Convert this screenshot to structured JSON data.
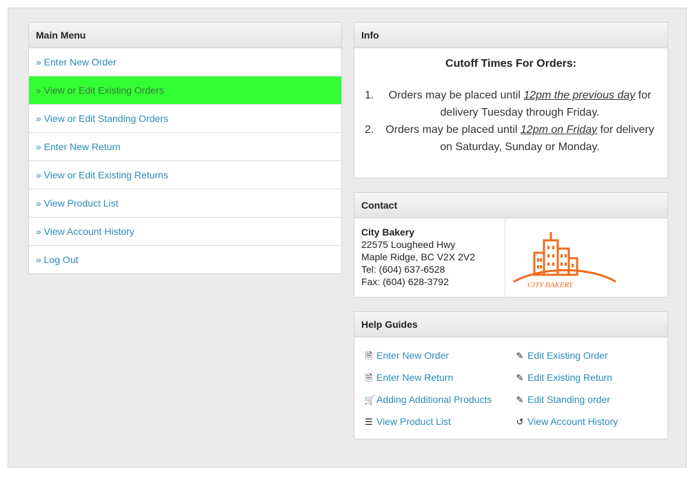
{
  "menu": {
    "title": "Main Menu",
    "items": [
      "» Enter New Order",
      "» View or Edit Existing Orders",
      "» View or Edit Standing Orders",
      "» Enter New Return",
      "» View or Edit Existing Returns",
      "» View Product List",
      "» View Account History",
      "» Log Out"
    ],
    "active_index": 1,
    "active_color": "#33ff33"
  },
  "info": {
    "title": "Info",
    "heading": "Cutoff Times For Orders:",
    "items": [
      {
        "num": "1.",
        "pre": "Orders may be placed until ",
        "em": "12pm the previous day",
        "post": " for delivery Tuesday through Friday."
      },
      {
        "num": "2.",
        "pre": "Orders may be placed until ",
        "em": "12pm on Friday",
        "post": " for delivery on Saturday, Sunday or Monday."
      }
    ]
  },
  "contact": {
    "title": "Contact",
    "name": "City Bakery",
    "address1": "22575 Lougheed Hwy",
    "address2": "Maple Ridge, BC V2X 2V2",
    "tel": "Tel: (604) 637-6528",
    "fax": "Fax: (604) 628-3792",
    "logo_text": "CITY BAKERY",
    "logo_color": "#f26b1d"
  },
  "help": {
    "title": "Help Guides",
    "links": [
      {
        "label": "Enter New Order",
        "icon": "document-icon"
      },
      {
        "label": "Edit Existing Order",
        "icon": "edit-icon"
      },
      {
        "label": "Enter New Return",
        "icon": "document-icon"
      },
      {
        "label": "Edit Existing Return",
        "icon": "edit-icon"
      },
      {
        "label": "Adding Additional Products",
        "icon": "cart-icon"
      },
      {
        "label": "Edit Standing order",
        "icon": "edit-icon"
      },
      {
        "label": "View Product List",
        "icon": "list-icon"
      },
      {
        "label": "View Account History",
        "icon": "history-icon"
      }
    ]
  },
  "colors": {
    "link": "#2a8bb8",
    "background": "#ebebeb"
  }
}
